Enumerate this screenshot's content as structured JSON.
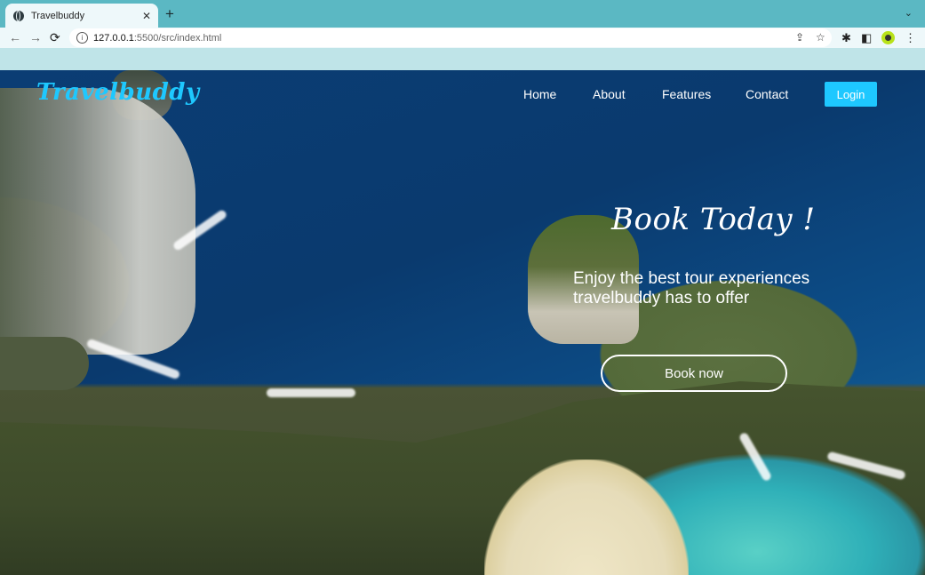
{
  "browser": {
    "tab_title": "Travelbuddy",
    "tab_close": "✕",
    "new_tab": "+",
    "tabs_menu": "⌄",
    "url_host": "127.0.0.1",
    "url_path": ":5500/src/index.html",
    "icons": {
      "back": "←",
      "forward": "→",
      "reload": "⟳",
      "info": "i",
      "share": "⇪",
      "bookmark": "☆",
      "extensions": "✱",
      "side_panel": "◧",
      "menu": "⋮"
    }
  },
  "site": {
    "logo": "Travelbuddy",
    "nav": [
      "Home",
      "About",
      "Features",
      "Contact"
    ],
    "login": "Login",
    "hero_title": "Book Today !",
    "hero_subtitle": "Enjoy the best tour experiences travelbuddy has to offer",
    "cta": "Book now",
    "accent_color": "#1ec8ff"
  }
}
